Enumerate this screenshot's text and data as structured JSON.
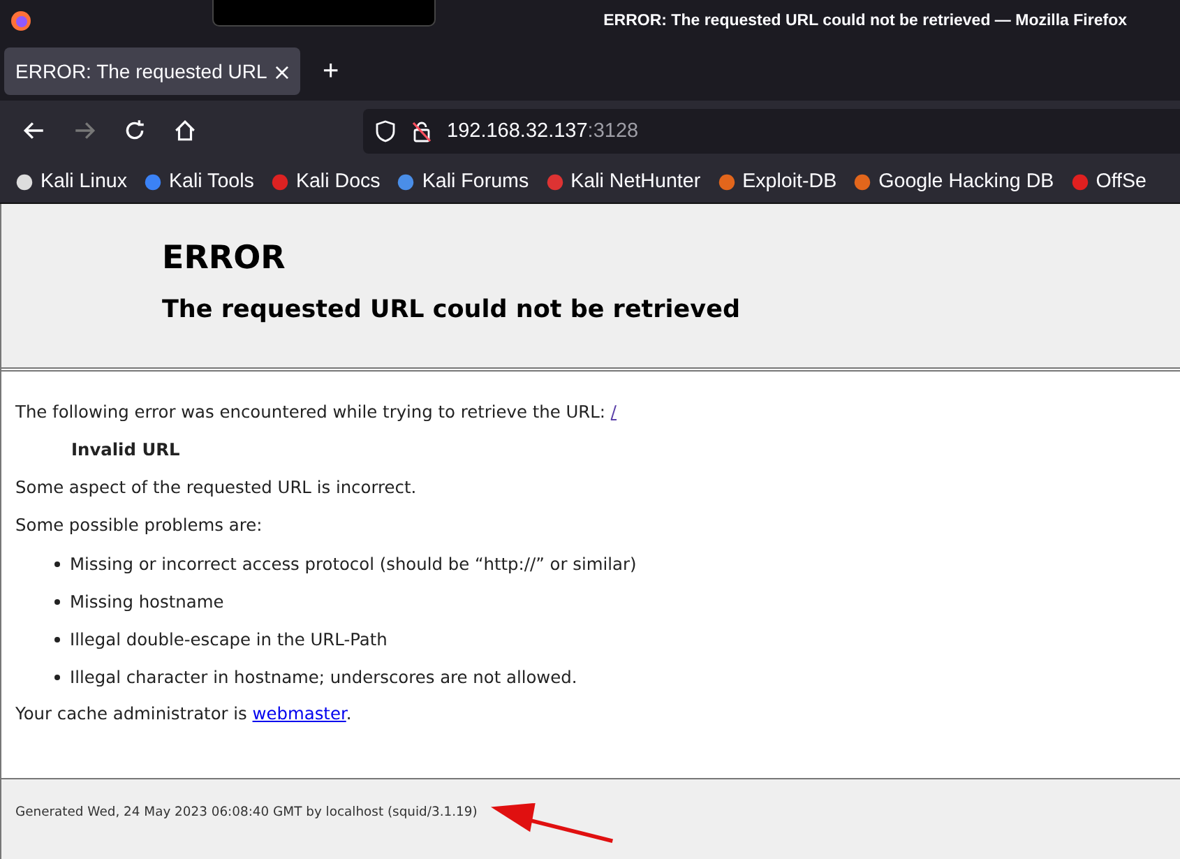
{
  "window": {
    "title": "ERROR: The requested URL could not be retrieved — Mozilla Firefox"
  },
  "tabs": [
    {
      "label": "ERROR: The requested URL",
      "selected": true,
      "close": "×"
    }
  ],
  "new_tab": "+",
  "address": {
    "host": "192.168.32.137",
    "port": ":3128"
  },
  "bookmarks": [
    {
      "label": "Kali Linux"
    },
    {
      "label": "Kali Tools"
    },
    {
      "label": "Kali Docs"
    },
    {
      "label": "Kali Forums"
    },
    {
      "label": "Kali NetHunter"
    },
    {
      "label": "Exploit-DB"
    },
    {
      "label": "Google Hacking DB"
    },
    {
      "label": "OffSe"
    }
  ],
  "page": {
    "heading": "ERROR",
    "subheading": "The requested URL could not be retrieved",
    "intro": "The following error was encountered while trying to retrieve the URL: ",
    "intro_link": "/",
    "error_name": "Invalid URL",
    "aspect": "Some aspect of the requested URL is incorrect.",
    "problems_intro": "Some possible problems are:",
    "problems": [
      "Missing or incorrect access protocol (should be “http://” or similar)",
      "Missing hostname",
      "Illegal double-escape in the URL-Path",
      "Illegal character in hostname; underscores are not allowed."
    ],
    "admin_text": "Your cache administrator is ",
    "admin_link": "webmaster",
    "admin_end": ".",
    "footer": "Generated Wed, 24 May 2023 06:08:40 GMT by localhost (squid/3.1.19)"
  }
}
